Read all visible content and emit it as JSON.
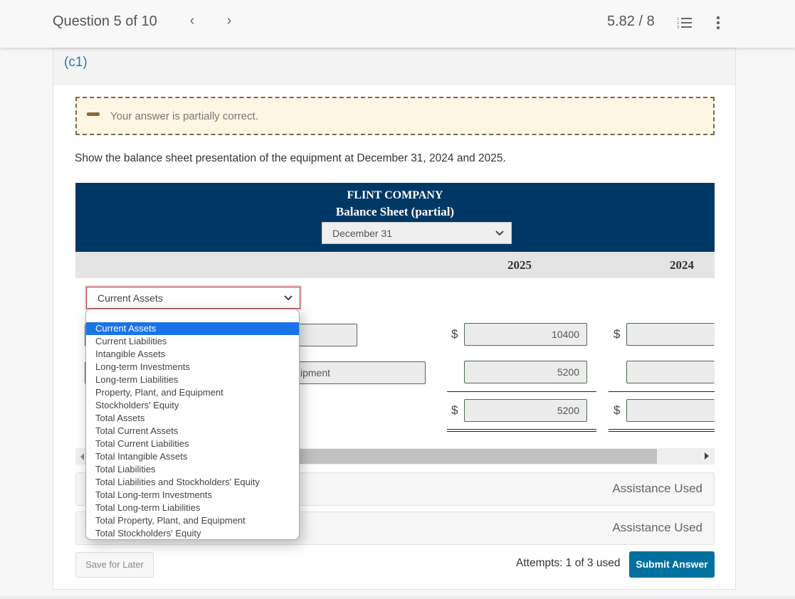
{
  "header": {
    "question_label": "Question 5 of 10",
    "prev_icon": "chevron-left-icon",
    "next_icon": "chevron-right-icon",
    "prev_glyph": "‹",
    "next_glyph": "›",
    "score": "5.82 / 8",
    "list_icon": "numbered-list-icon",
    "more_icon": "more-vertical-icon"
  },
  "part": {
    "label": "(c1)"
  },
  "feedback": {
    "icon": "partial-dash-icon",
    "text": "Your answer is partially correct."
  },
  "instructions": "Show the balance sheet presentation of the equipment at December 31, 2024 and 2025.",
  "balance_sheet": {
    "company": "FLINT COMPANY",
    "title": "Balance Sheet (partial)",
    "date_select": "December 31",
    "columns": [
      "2025",
      "2024"
    ],
    "category_select": "Current Assets",
    "currency_symbol": "$",
    "rows": [
      {
        "label": "",
        "v2025": "10400",
        "v2024": ""
      },
      {
        "label": "ipment",
        "v2025": "5200",
        "v2024": ""
      },
      {
        "label": "",
        "v2025": "5200",
        "v2024": ""
      }
    ]
  },
  "dropdown": {
    "selected": "Current Assets",
    "options": [
      "Current Assets",
      "Current Liabilities",
      "Intangible Assets",
      "Long-term Investments",
      "Long-term Liabilities",
      "Property, Plant, and Equipment",
      "Stockholders' Equity",
      "Total Assets",
      "Total Current Assets",
      "Total Current Liabilities",
      "Total Intangible Assets",
      "Total Liabilities",
      "Total Liabilities and Stockholders' Equity",
      "Total Long-term Investments",
      "Total Long-term Liabilities",
      "Total Property, Plant, and Equipment",
      "Total Stockholders' Equity"
    ]
  },
  "assistance": [
    "Assistance Used",
    "Assistance Used"
  ],
  "footer": {
    "save_label": "Save for Later",
    "attempts": "Attempts: 1 of 3 used",
    "submit_label": "Submit Answer"
  },
  "colors": {
    "header_navy": "#003865",
    "submit_blue": "#00709f",
    "part_label_blue": "#2a7aa6",
    "feedback_bg": "#fdf6e3",
    "selected_option": "#1a73e8"
  }
}
